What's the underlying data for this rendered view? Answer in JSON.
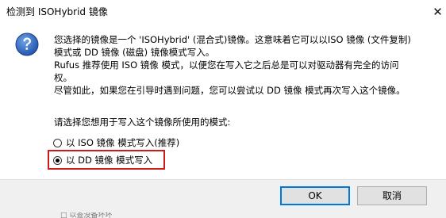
{
  "window": {
    "title": "检测到 ISOHybrid 镜像",
    "close_glyph": "✕"
  },
  "message": {
    "icon": "question-icon",
    "lines": [
      "您选择的镜像是一个 'ISOHybrid' (混合式)镜像。这意味着它可以以ISO 镜像 (文件复制)",
      "模式或 DD 镜像 (磁盘) 镜像模式写入。",
      "Rufus 推荐使用 ISO 镜像 模式，以便您在写入它之后总是可以对驱动器有完全的访问",
      "权。",
      "尽管如此，如果您在引导时遇到问题，您可以尝试以 DD 镜像 模式再次写入这个镜像。"
    ],
    "prompt": "请选择您想用于写入这个镜像所使用的模式:"
  },
  "options": [
    {
      "label": "以 ISO 镜像 模式写入(推荐)",
      "selected": false
    },
    {
      "label": "以 DD 镜像 模式写入",
      "selected": true
    }
  ],
  "buttons": {
    "ok": "OK",
    "cancel": "取消"
  },
  "underlay": {
    "text": "□ 以查没备坏坏"
  },
  "colors": {
    "highlight_border": "#d01a1a",
    "default_button_border": "#0078d7",
    "footer_bg": "#f0f0f0"
  }
}
